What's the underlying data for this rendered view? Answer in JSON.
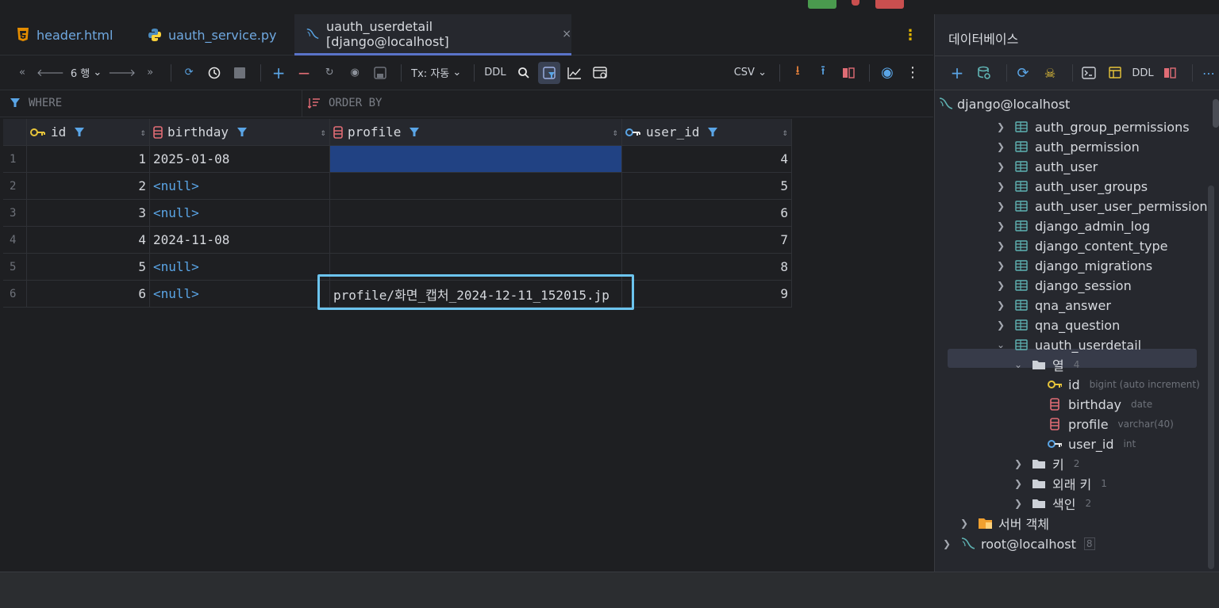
{
  "tabs": [
    {
      "label": "header.html",
      "icon": "html5-icon"
    },
    {
      "label": "uauth_service.py",
      "icon": "python-icon"
    },
    {
      "label": "uauth_userdetail [django@localhost]",
      "icon": "mysql-icon"
    }
  ],
  "tab_close": "×",
  "toolbar": {
    "rows_label": "6 행",
    "tx_label": "Tx: 자동",
    "ddl_label": "DDL",
    "csv_label": "CSV"
  },
  "filter": {
    "where_label": "WHERE",
    "orderby_label": "ORDER BY"
  },
  "grid": {
    "columns": [
      "id",
      "birthday",
      "profile",
      "user_id"
    ],
    "rows": [
      {
        "rn": "1",
        "id": "1",
        "birthday": "2025-01-08",
        "profile": "",
        "user_id": "4"
      },
      {
        "rn": "2",
        "id": "2",
        "birthday": "<null>",
        "profile": "",
        "user_id": "5"
      },
      {
        "rn": "3",
        "id": "3",
        "birthday": "<null>",
        "profile": "",
        "user_id": "6"
      },
      {
        "rn": "4",
        "id": "4",
        "birthday": "2024-11-08",
        "profile": "",
        "user_id": "7"
      },
      {
        "rn": "5",
        "id": "5",
        "birthday": "<null>",
        "profile": "",
        "user_id": "8"
      },
      {
        "rn": "6",
        "id": "6",
        "birthday": "<null>",
        "profile": "profile/화면_캡처_2024-12-11_152015.jp",
        "user_id": "9"
      }
    ]
  },
  "db_panel": {
    "title": "데이터베이스",
    "ddl_label": "DDL",
    "connection": "django@localhost",
    "tables": [
      "auth_group_permissions",
      "auth_permission",
      "auth_user",
      "auth_user_groups",
      "auth_user_user_permissions",
      "django_admin_log",
      "django_content_type",
      "django_migrations",
      "django_session",
      "qna_answer",
      "qna_question",
      "uauth_userdetail"
    ],
    "columns_folder": {
      "label": "열",
      "count": "4"
    },
    "columns": [
      {
        "name": "id",
        "type": "bigint (auto increment)"
      },
      {
        "name": "birthday",
        "type": "date"
      },
      {
        "name": "profile",
        "type": "varchar(40)"
      },
      {
        "name": "user_id",
        "type": "int"
      }
    ],
    "keys_folder": {
      "label": "키",
      "count": "2"
    },
    "fk_folder": {
      "label": "외래 키",
      "count": "1"
    },
    "index_folder": {
      "label": "색인",
      "count": "2"
    },
    "server_objects": "서버 객체",
    "root_connection": "root@localhost",
    "root_count": "8"
  },
  "colors": {
    "accent": "#5a73c8",
    "selection": "#214283",
    "highlight_box": "#6cc4ee",
    "null_text": "#5aa5e6",
    "key_icon": "#e8c53a",
    "column_icon": "#e06c75",
    "table_icon": "#5fb3b3"
  }
}
